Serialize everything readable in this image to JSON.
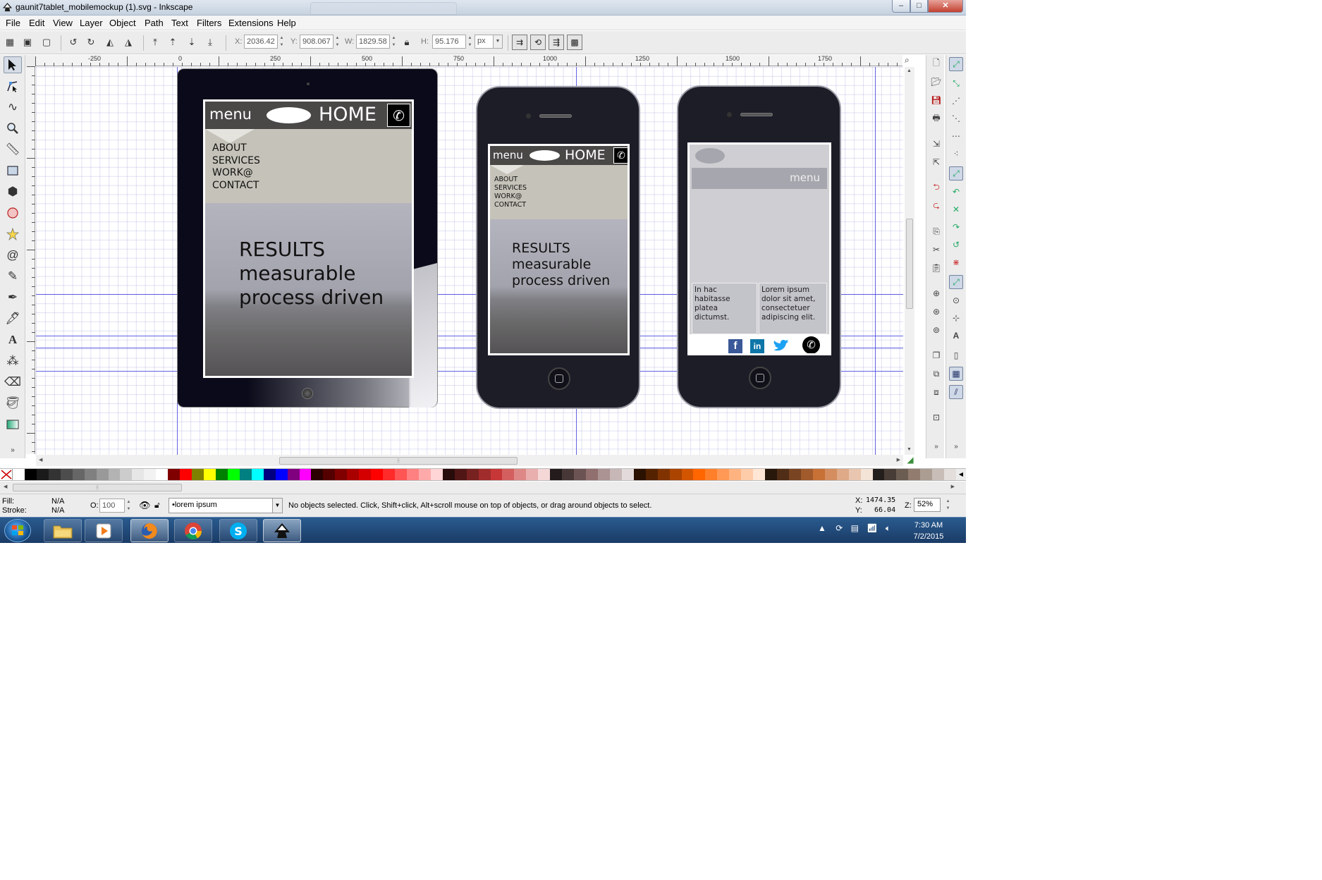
{
  "window": {
    "title": "gaunit7tablet_mobilemockup (1).svg - Inkscape",
    "min_glyph": "–",
    "max_glyph": "□",
    "close_glyph": "✕"
  },
  "menubar": {
    "items": [
      {
        "label": "File"
      },
      {
        "label": "Edit"
      },
      {
        "label": "View"
      },
      {
        "label": "Layer"
      },
      {
        "label": "Object"
      },
      {
        "label": "Path"
      },
      {
        "label": "Text"
      },
      {
        "label": "Filters"
      },
      {
        "label": "Extensions"
      },
      {
        "label": "Help"
      }
    ]
  },
  "toolbar": {
    "x_label": "X:",
    "x_value": "2036.42",
    "y_label": "Y:",
    "y_value": "908.067",
    "w_label": "W:",
    "w_value": "1829.58",
    "h_label": "H:",
    "h_value": "95.176",
    "unit": "px"
  },
  "ruler": {
    "labels": [
      "-250",
      "0",
      "250",
      "500",
      "750",
      "1000",
      "1250",
      "1500",
      "1750"
    ]
  },
  "tablet_mockup": {
    "nav_menu": "menu",
    "nav_home": "HOME",
    "links": [
      "ABOUT",
      "SERVICES",
      "WORK@",
      "CONTACT"
    ],
    "hero": [
      "RESULTS",
      "measurable",
      "process driven"
    ]
  },
  "phone_mockup_1": {
    "nav_menu": "menu",
    "nav_home": "HOME",
    "links": [
      "ABOUT",
      "SERVICES",
      "WORK@",
      "CONTACT"
    ],
    "hero": [
      "RESULTS",
      "measurable",
      "process driven"
    ]
  },
  "phone_mockup_2": {
    "menu_label": "menu",
    "col_left": "In hac habitasse platea dictumst.",
    "col_right": "Lorem ipsum dolor sit amet, consectetuer adipiscing elit.",
    "social": [
      "facebook-icon",
      "linkedin-icon",
      "twitter-icon",
      "phone-icon"
    ]
  },
  "palette": {
    "colors": [
      "#ffffff",
      "#000000",
      "#1a1a1a",
      "#333333",
      "#4d4d4d",
      "#666666",
      "#808080",
      "#999999",
      "#b3b3b3",
      "#cccccc",
      "#e6e6e6",
      "#f2f2f2",
      "#ffffff",
      "#800000",
      "#ff0000",
      "#808000",
      "#ffff00",
      "#008000",
      "#00ff00",
      "#008080",
      "#00ffff",
      "#000080",
      "#0000ff",
      "#800080",
      "#ff00ff",
      "#2b0000",
      "#550000",
      "#800000",
      "#aa0000",
      "#d40000",
      "#ff0000",
      "#ff2a2a",
      "#ff5555",
      "#ff8080",
      "#ffaaaa",
      "#ffd5d5",
      "#280b0b",
      "#501616",
      "#782121",
      "#a02c2c",
      "#c83737",
      "#d35f5f",
      "#de8787",
      "#e9afaf",
      "#f4d7d7",
      "#241c1c",
      "#483737",
      "#6c5353",
      "#916f6f",
      "#ac9393",
      "#c8b7b7",
      "#e3dbdb",
      "#2b1100",
      "#552200",
      "#803300",
      "#aa4400",
      "#d45500",
      "#ff6600",
      "#ff7f2a",
      "#ff9955",
      "#ffb380",
      "#ffccaa",
      "#ffe6d5",
      "#28170b",
      "#502d16",
      "#784421",
      "#a05a2c",
      "#c87137",
      "#d38d5f",
      "#deaa87",
      "#e9c6af",
      "#f4e3d7",
      "#241f1c",
      "#483e37",
      "#6c5d53",
      "#917c6f",
      "#ac9d93",
      "#c8beb7",
      "#e3dedb"
    ]
  },
  "status": {
    "fill_label": "Fill:",
    "fill_value": "N/A",
    "stroke_label": "Stroke:",
    "stroke_value": "N/A",
    "opacity_label": "O:",
    "opacity_value": "100",
    "layer": "•lorem ipsum",
    "message": "No objects selected. Click, Shift+click, Alt+scroll mouse on top of objects, or drag around objects to select.",
    "cursor_x_label": "X:",
    "cursor_x": "1474.35",
    "cursor_y_label": "Y:",
    "cursor_y": "66.04",
    "zoom_label": "Z:",
    "zoom": "52%"
  },
  "taskbar": {
    "apps": [
      "folder-icon",
      "media-player-icon",
      "firefox-icon",
      "chrome-icon",
      "skype-icon",
      "inkscape-icon"
    ],
    "time": "7:30 AM",
    "date": "7/2/2015"
  }
}
